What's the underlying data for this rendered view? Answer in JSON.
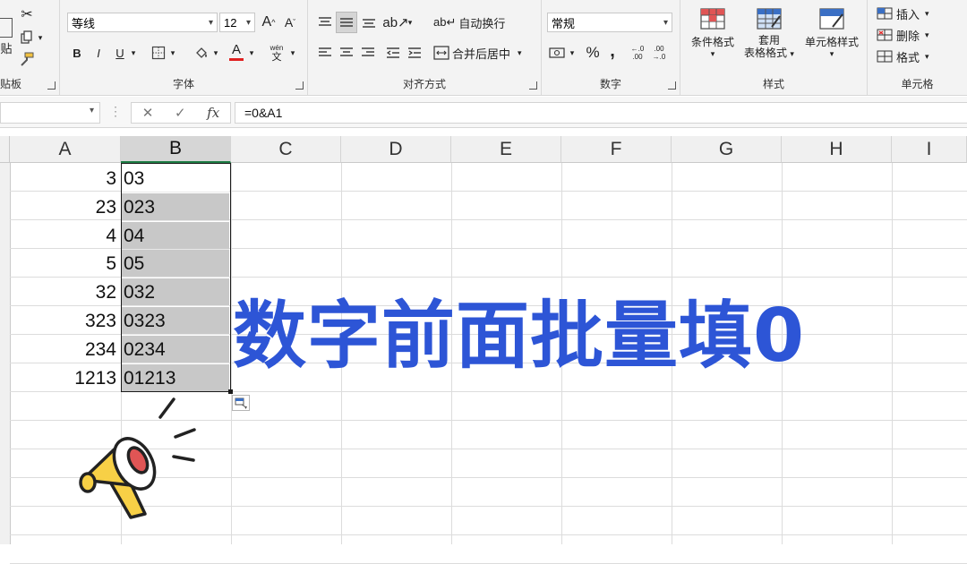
{
  "ribbon": {
    "clipboard": {
      "paste_label": "贴",
      "group_label": "贴板"
    },
    "font": {
      "font_name": "等线",
      "font_size": "12",
      "bold": "B",
      "italic": "I",
      "underline": "U",
      "font_color_letter": "A",
      "phonetic_top": "wén",
      "phonetic_bottom": "文",
      "grow": "A",
      "shrink": "A",
      "group_label": "字体"
    },
    "alignment": {
      "wrap_text": "自动换行",
      "merge_center": "合并后居中",
      "group_label": "对齐方式"
    },
    "number": {
      "format": "常规",
      "percent": "%",
      "comma": ",",
      "inc_decimal": "←.0 .00",
      "dec_decimal": ".00 →.0",
      "group_label": "数字"
    },
    "styles": {
      "conditional": "条件格式",
      "table_format_1": "套用",
      "table_format_2": "表格格式",
      "cell_styles": "单元格样式",
      "group_label": "样式"
    },
    "cells": {
      "insert": "插入",
      "delete": "删除",
      "format": "格式",
      "group_label": "单元格"
    }
  },
  "formula_bar": {
    "formula": "=0&A1",
    "fx": "fx"
  },
  "columns": [
    "A",
    "B",
    "C",
    "D",
    "E",
    "F",
    "G",
    "H",
    "I"
  ],
  "rows": [
    {
      "a": "3",
      "b": "03"
    },
    {
      "a": "23",
      "b": "023"
    },
    {
      "a": "4",
      "b": "04"
    },
    {
      "a": "5",
      "b": "05"
    },
    {
      "a": "32",
      "b": "032"
    },
    {
      "a": "323",
      "b": "0323"
    },
    {
      "a": "234",
      "b": "0234"
    },
    {
      "a": "1213",
      "b": "01213"
    }
  ],
  "overlay_title": "数字前面批量填0",
  "colors": {
    "title_blue": "#2d55d6",
    "font_color_red": "#e02020",
    "megaphone_yellow": "#f7d046",
    "megaphone_red": "#e05555"
  }
}
